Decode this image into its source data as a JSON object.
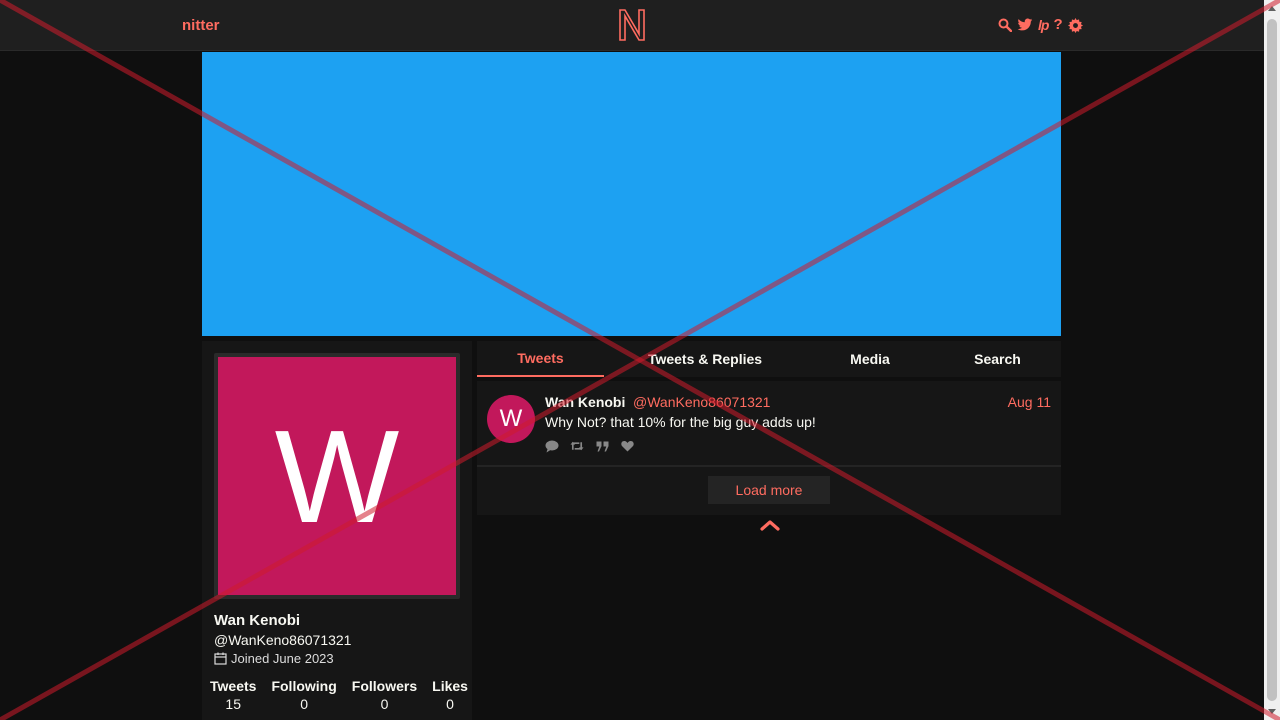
{
  "nav": {
    "brand": "nitter",
    "ip_label": "lp",
    "help_label": "?"
  },
  "profile": {
    "avatar_letter": "W",
    "fullname": "Wan Kenobi",
    "username": "@WanKeno86071321",
    "joined": "Joined June 2023",
    "stats": [
      {
        "label": "Tweets",
        "value": "15"
      },
      {
        "label": "Following",
        "value": "0"
      },
      {
        "label": "Followers",
        "value": "0"
      },
      {
        "label": "Likes",
        "value": "0"
      }
    ]
  },
  "tabs": [
    {
      "label": "Tweets",
      "active": true
    },
    {
      "label": "Tweets & Replies",
      "active": false
    },
    {
      "label": "Media",
      "active": false
    },
    {
      "label": "Search",
      "active": false
    }
  ],
  "tweet": {
    "avatar_letter": "W",
    "name": "Wan Kenobi",
    "handle": "@WanKeno86071321",
    "date": "Aug 11",
    "text": "Why Not? that 10% for the big guy adds up!"
  },
  "load_more": "Load more",
  "colors": {
    "accent": "#ff6c60",
    "banner": "#1da1f2",
    "avatar": "#c2185b",
    "background": "#0f0f0f",
    "panel": "#161616"
  }
}
